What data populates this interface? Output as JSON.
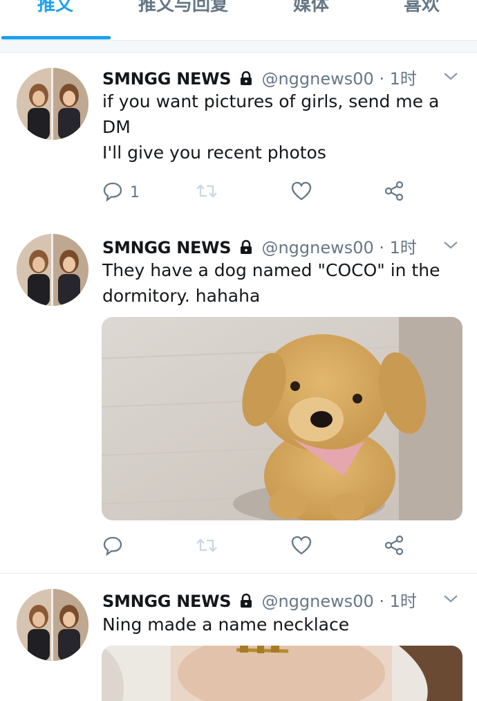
{
  "tabs": [
    {
      "label": "推文",
      "active": true
    },
    {
      "label": "推文与回复",
      "active": false
    },
    {
      "label": "媒体",
      "active": false
    },
    {
      "label": "喜欢",
      "active": false
    }
  ],
  "accent_color": "#1da1f2",
  "tweets": [
    {
      "display_name": "SMNGG NEWS",
      "handle_time": "@nggnews00 · 1时",
      "lines": [
        "if you want pictures of girls, send me a",
        "DM",
        "I'll give you recent photos"
      ],
      "reply_count": "1",
      "has_media": false
    },
    {
      "display_name": "SMNGG NEWS",
      "handle_time": "@nggnews00 · 1时",
      "lines": [
        "They have a dog named \"COCO\" in the",
        "dormitory. hahaha"
      ],
      "reply_count": "",
      "has_media": true,
      "media_icon": "plush-dog-photo"
    },
    {
      "display_name": "SMNGG NEWS",
      "handle_time": "@nggnews00 · 1时",
      "lines": [
        "Ning made a name necklace"
      ],
      "has_media": true,
      "media_icon": "necklace-photo"
    }
  ],
  "icons": {
    "reply": "reply-icon",
    "retweet": "retweet-icon",
    "like": "heart-icon",
    "share": "share-icon",
    "protected": "lock-icon",
    "menu": "chevron-down-icon"
  }
}
